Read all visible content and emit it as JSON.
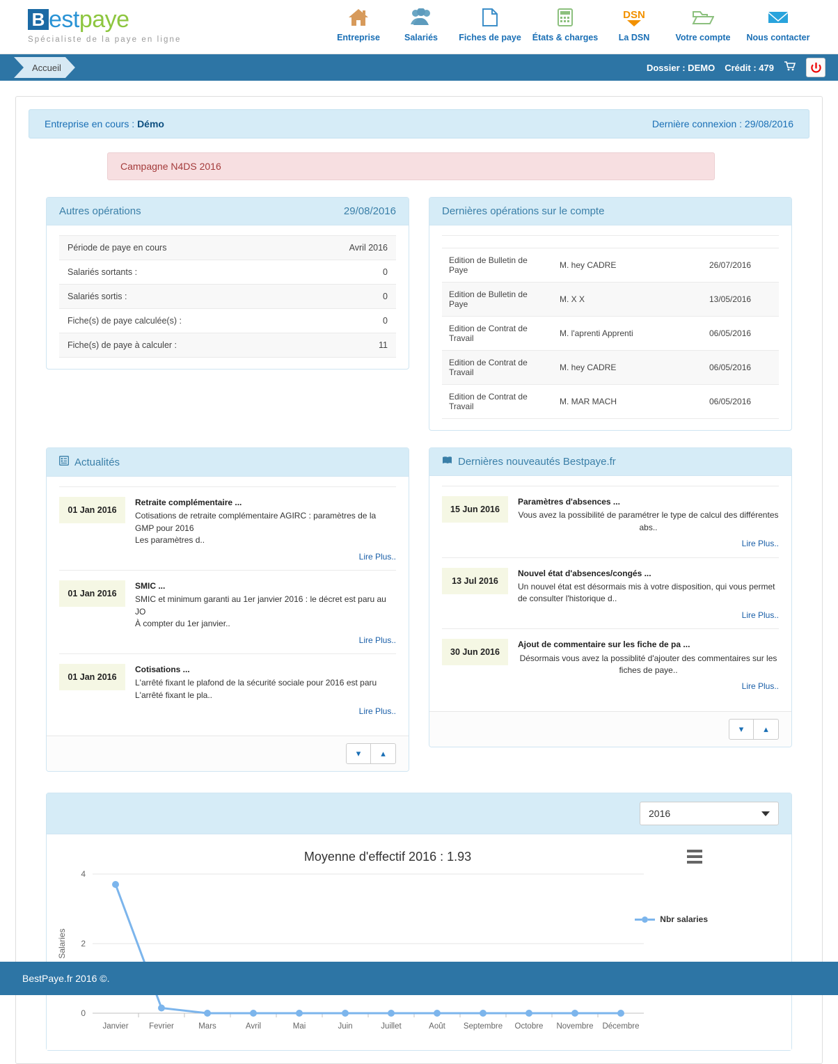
{
  "brand": {
    "logo_b": "B",
    "logo_est": "est",
    "logo_paye": "paye",
    "tagline": "Spécialiste de la paye en ligne"
  },
  "nav": {
    "items": [
      {
        "label": "Entreprise",
        "icon": "home-icon"
      },
      {
        "label": "Salariés",
        "icon": "users-icon"
      },
      {
        "label": "Fiches de paye",
        "icon": "document-icon"
      },
      {
        "label": "États & charges",
        "icon": "calculator-icon"
      },
      {
        "label": "La DSN",
        "icon": "dsn-icon"
      },
      {
        "label": "Votre compte",
        "icon": "folder-icon"
      },
      {
        "label": "Nous contacter",
        "icon": "envelope-icon"
      }
    ]
  },
  "breadcrumb": {
    "label": "Accueil",
    "dossier": "Dossier : DEMO",
    "credit": "Crédit : 479",
    "cart_icon": "cart-icon",
    "power_icon": "power-icon"
  },
  "enterprise_bar": {
    "label": "Entreprise en cours :",
    "name": "Démo",
    "last_connection": "Dernière connexion : 29/08/2016"
  },
  "campaign": {
    "label": "Campagne N4DS 2016"
  },
  "other_operations": {
    "title": "Autres opérations",
    "date": "29/08/2016",
    "rows": [
      {
        "label": "Période de paye en cours",
        "value": "Avril 2016"
      },
      {
        "label": "Salariés sortants :",
        "value": "0"
      },
      {
        "label": "Salariés sortis :",
        "value": "0"
      },
      {
        "label": "Fiche(s) de paye calculée(s) :",
        "value": "0"
      },
      {
        "label": "Fiche(s) de paye à calculer :",
        "value": "11"
      }
    ]
  },
  "last_operations": {
    "title": "Dernières opérations sur le compte",
    "rows": [
      {
        "operation": "Edition de Bulletin de Paye",
        "person": "M. hey CADRE",
        "date": "26/07/2016"
      },
      {
        "operation": "Edition de Bulletin de Paye",
        "person": "M. X X",
        "date": "13/05/2016"
      },
      {
        "operation": "Edition de Contrat de Travail",
        "person": "M. l'aprenti Apprenti",
        "date": "06/05/2016"
      },
      {
        "operation": "Edition de Contrat de Travail",
        "person": "M. hey CADRE",
        "date": "06/05/2016"
      },
      {
        "operation": "Edition de Contrat de Travail",
        "person": "M. MAR MACH",
        "date": "06/05/2016"
      }
    ]
  },
  "actualites": {
    "title": "Actualités",
    "icon": "list-icon",
    "read_more": "Lire Plus..",
    "items": [
      {
        "date": "01 Jan 2016",
        "title": "Retraite complémentaire ...",
        "body": "Cotisations de retraite complémentaire AGIRC : paramètres de la GMP pour 2016\nLes paramètres d.."
      },
      {
        "date": "01 Jan 2016",
        "title": "SMIC ...",
        "body": "SMIC et minimum garanti au 1er janvier 2016 : le décret est paru au JO\nÀ compter du 1er janvier.."
      },
      {
        "date": "01 Jan 2016",
        "title": "Cotisations ...",
        "body": "L'arrêté fixant le plafond de la sécurité sociale pour 2016 est paru\nL'arrêté fixant le pla.."
      }
    ],
    "down_icon": "chevron-down-icon",
    "up_icon": "chevron-up-icon"
  },
  "nouveautes": {
    "title": "Dernières nouveautés Bestpaye.fr",
    "icon": "book-icon",
    "read_more": "Lire Plus..",
    "items": [
      {
        "date": "15 Jun 2016",
        "title": "Paramètres d'absences ...",
        "body": "Vous avez la possibilité de paramétrer le type de calcul des différentes abs.."
      },
      {
        "date": "13 Jul 2016",
        "title": "Nouvel état d'absences/congés ...",
        "body": "Un nouvel état est désormais mis à votre disposition, qui vous permet de consulter l'historique d.."
      },
      {
        "date": "30 Jun 2016",
        "title": "Ajout de commentaire sur les fiche de pa ...",
        "body": "Désormais vous avez la possiblité d'ajouter des commentaires sur les fiches de paye.."
      }
    ],
    "down_icon": "chevron-down-icon",
    "up_icon": "chevron-up-icon"
  },
  "chart_panel": {
    "year_selected": "2016",
    "menu_icon": "hamburger-menu-icon"
  },
  "chart_data": {
    "type": "line",
    "title": "Moyenne d'effectif 2016 : 1.93",
    "xlabel": "",
    "ylabel": "Salaries",
    "categories": [
      "Janvier",
      "Fevrier",
      "Mars",
      "Avril",
      "Mai",
      "Juin",
      "Juillet",
      "Août",
      "Septembre",
      "Octobre",
      "Novembre",
      "Décembre"
    ],
    "series": [
      {
        "name": "Nbr salaries",
        "values": [
          3.7,
          0.15,
          0,
          0,
          0,
          0,
          0,
          0,
          0,
          0,
          0,
          0
        ],
        "color": "#7cb5ec"
      }
    ],
    "ylim": [
      0,
      4
    ],
    "yticks": [
      0,
      2,
      4
    ],
    "grid": true,
    "legend_position": "right"
  },
  "footer": {
    "text": "BestPaye.fr 2016 ©."
  },
  "colors": {
    "primary_blue": "#2d75a5",
    "light_blue": "#d6ecf7",
    "link_blue": "#1a6fb5",
    "green": "#8dc63f",
    "series_blue": "#7cb5ec",
    "campaign_bg": "#f7dfe1",
    "campaign_text": "#a43b3b"
  }
}
